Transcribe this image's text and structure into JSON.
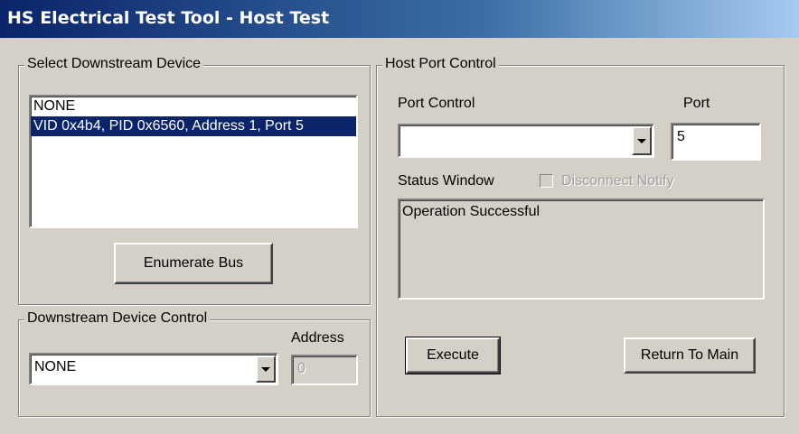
{
  "window": {
    "title": "HS Electrical Test Tool - Host Test"
  },
  "downstream_select": {
    "group_label": "Select Downstream Device",
    "devices": [
      {
        "label": "NONE",
        "selected": false
      },
      {
        "label": "VID 0x4b4, PID 0x6560, Address 1, Port 5",
        "selected": true
      }
    ],
    "enumerate_label": "Enumerate Bus"
  },
  "downstream_control": {
    "group_label": "Downstream Device Control",
    "combo_value": "NONE",
    "address_label": "Address",
    "address_value": "0"
  },
  "host_port": {
    "group_label": "Host Port Control",
    "port_control_label": "Port Control",
    "port_control_value": "",
    "port_label": "Port",
    "port_value": "5",
    "status_label": "Status Window",
    "disconnect_label": "Disconnect Notify",
    "status_text": "Operation Successful",
    "execute_label": "Execute",
    "return_label": "Return To Main"
  }
}
